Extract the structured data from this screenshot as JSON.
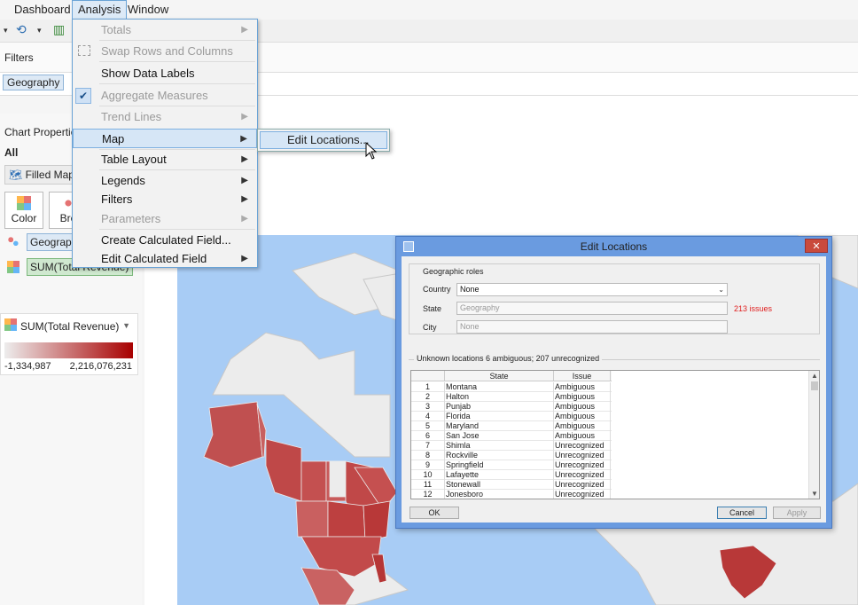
{
  "menubar": {
    "dashboard": "Dashboard",
    "analysis": "Analysis",
    "window": "Window"
  },
  "shelves": {
    "filters_label": "Filters",
    "geography_filter": "Geography"
  },
  "marks": {
    "chart_properties": "Chart Properties",
    "all": "All",
    "mark_type": "Filled Map",
    "color_card": "Color",
    "break_card": "Bre",
    "geography_pill": "Geography",
    "sum_pill": "SUM(Total Revenue)"
  },
  "legend": {
    "title": "SUM(Total Revenue)",
    "min": "-1,334,987",
    "max": "2,216,076,231",
    "low_color": "#ededed",
    "high_color": "#a80000"
  },
  "analysis_menu": {
    "totals": "Totals",
    "swap": "Swap Rows and Columns",
    "show_labels": "Show Data Labels",
    "aggregate": "Aggregate Measures",
    "trend": "Trend Lines",
    "map": "Map",
    "table_layout": "Table Layout",
    "legends": "Legends",
    "filters": "Filters",
    "parameters": "Parameters",
    "create_calc": "Create Calculated Field...",
    "edit_calc": "Edit Calculated Field"
  },
  "map_submenu": {
    "edit_locations": "Edit Locations..."
  },
  "dialog": {
    "title": "Edit Locations",
    "close": "✕",
    "geo_roles": "Geographic roles",
    "country_label": "Country",
    "country_value": "None",
    "state_label": "State",
    "state_value": "Geography",
    "city_label": "City",
    "city_value": "None",
    "issues": "213 issues",
    "unknown": "Unknown locations  6 ambiguous; 207 unrecognized",
    "col_state": "State",
    "col_issue": "Issue",
    "rows": [
      {
        "n": "1",
        "state": "Montana",
        "issue": "Ambiguous"
      },
      {
        "n": "2",
        "state": "Halton",
        "issue": "Ambiguous"
      },
      {
        "n": "3",
        "state": "Punjab",
        "issue": "Ambiguous"
      },
      {
        "n": "4",
        "state": "Florida",
        "issue": "Ambiguous"
      },
      {
        "n": "5",
        "state": "Maryland",
        "issue": "Ambiguous"
      },
      {
        "n": "6",
        "state": "San Jose",
        "issue": "Ambiguous"
      },
      {
        "n": "7",
        "state": "Shimla",
        "issue": "Unrecognized"
      },
      {
        "n": "8",
        "state": "Rockville",
        "issue": "Unrecognized"
      },
      {
        "n": "9",
        "state": "Springfield",
        "issue": "Unrecognized"
      },
      {
        "n": "10",
        "state": "Lafayette",
        "issue": "Unrecognized"
      },
      {
        "n": "11",
        "state": "Stonewall",
        "issue": "Unrecognized"
      },
      {
        "n": "12",
        "state": "Jonesboro",
        "issue": "Unrecognized"
      }
    ],
    "ok": "OK",
    "cancel": "Cancel",
    "apply": "Apply"
  },
  "colors": {
    "water": "#a8ccf5",
    "land": "#ececec",
    "region_mid": "#c44a4a",
    "region_dark": "#b83838"
  }
}
